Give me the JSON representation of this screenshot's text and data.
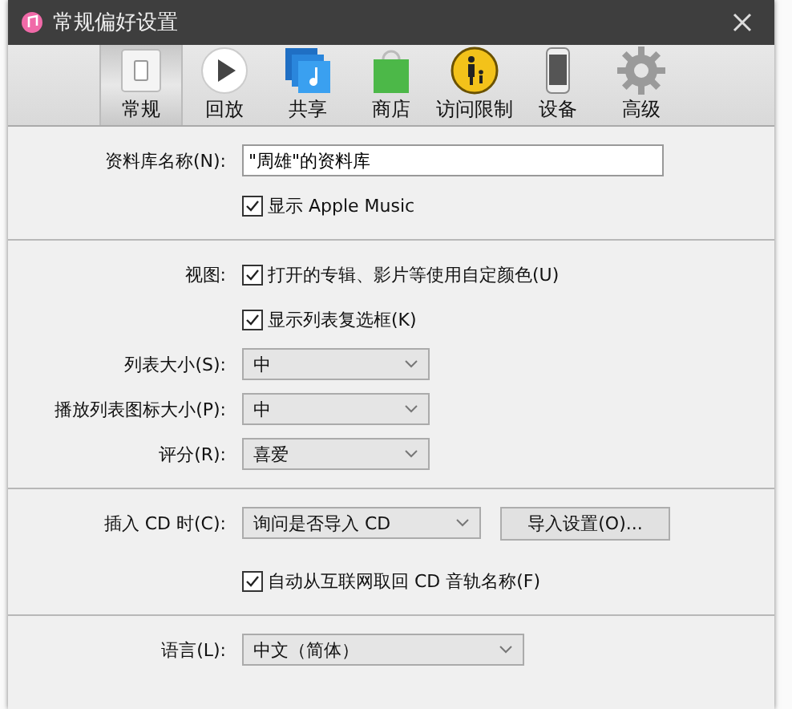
{
  "window": {
    "title": "常规偏好设置"
  },
  "tabs": [
    {
      "label": "常规",
      "kind": "switch",
      "selected": true
    },
    {
      "label": "回放",
      "kind": "play",
      "selected": false
    },
    {
      "label": "共享",
      "kind": "music",
      "selected": false
    },
    {
      "label": "商店",
      "kind": "bag",
      "selected": false
    },
    {
      "label": "访问限制",
      "kind": "parental",
      "selected": false
    },
    {
      "label": "设备",
      "kind": "phone",
      "selected": false
    },
    {
      "label": "高级",
      "kind": "gear",
      "selected": false
    }
  ],
  "sections": [
    {
      "rows": [
        {
          "kind": "text",
          "label": "资料库名称(N):",
          "value": "\"周雄\"的资料库"
        },
        {
          "kind": "checkbox",
          "text": "显示 Apple Music",
          "checked": true
        }
      ]
    },
    {
      "rows": [
        {
          "kind": "checkbox",
          "label": "视图:",
          "text": "打开的专辑、影片等使用自定颜色(U)",
          "checked": true
        },
        {
          "kind": "checkbox",
          "text": "显示列表复选框(K)",
          "checked": true
        },
        {
          "kind": "select",
          "label": "列表大小(S):",
          "value": "中"
        },
        {
          "kind": "select",
          "label": "播放列表图标大小(P):",
          "value": "中"
        },
        {
          "kind": "select",
          "label": "评分(R):",
          "value": "喜爱"
        }
      ]
    },
    {
      "rows": [
        {
          "kind": "select",
          "label": "插入 CD 时(C):",
          "value": "询问是否导入 CD",
          "button": "导入设置(O)..."
        },
        {
          "kind": "checkbox",
          "text": "自动从互联网取回 CD 音轨名称(F)",
          "checked": true
        }
      ]
    },
    {
      "rows": [
        {
          "kind": "select",
          "label": "语言(L):",
          "value": "中文（简体）"
        }
      ]
    }
  ]
}
